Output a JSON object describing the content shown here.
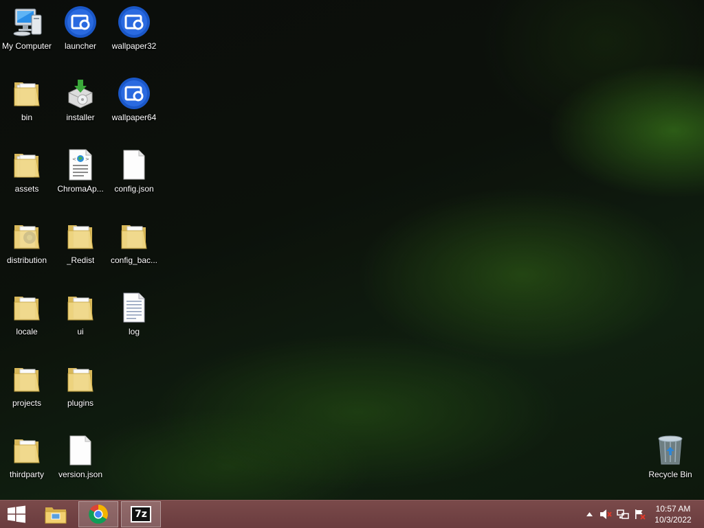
{
  "desktop": {
    "icons": {
      "my_computer": "My Computer",
      "launcher": "launcher",
      "wallpaper32": "wallpaper32",
      "bin": "bin",
      "installer": "installer",
      "wallpaper64": "wallpaper64",
      "assets": "assets",
      "chroma_app": "ChromaAp...",
      "config_json": "config.json",
      "distribution": "distribution",
      "redist": "_Redist",
      "config_backup": "config_bac...",
      "locale": "locale",
      "ui": "ui",
      "log": "log",
      "projects": "projects",
      "plugins": "plugins",
      "thirdparty": "thirdparty",
      "version_json": "version.json",
      "recycle_bin": "Recycle Bin"
    }
  },
  "taskbar": {
    "clock": {
      "time": "10:57 AM",
      "date": "10/3/2022"
    },
    "pinned": [
      "file-explorer",
      "chrome",
      "7zip"
    ],
    "sevenzip_label": "7z",
    "colors": {
      "bar": "#6e4042",
      "accent_blue": "#1a57c8"
    }
  }
}
